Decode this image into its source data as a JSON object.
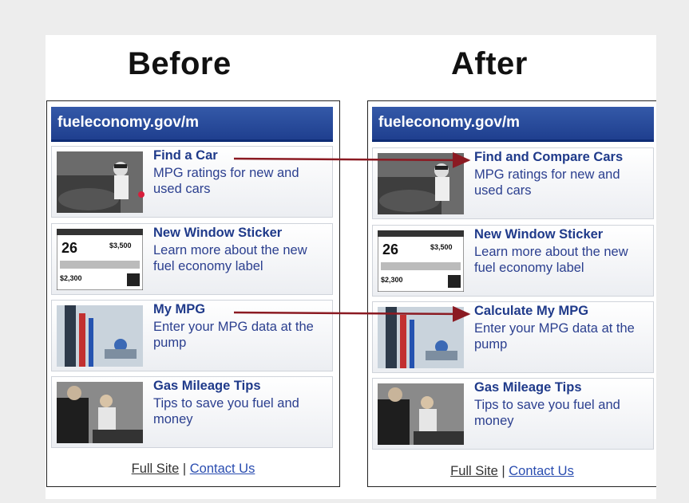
{
  "headings": {
    "before": "Before",
    "after": "After"
  },
  "site_header": "fueleconomy.gov/m",
  "before": {
    "cards": [
      {
        "title": "Find a Car",
        "desc": "MPG ratings for new and used cars",
        "thumb": "car-photo"
      },
      {
        "title": "New Window Sticker",
        "desc": "Learn more about the new fuel economy label",
        "thumb": "sticker-image"
      },
      {
        "title": "My MPG",
        "desc": "Enter your MPG data at the pump",
        "thumb": "fuel-pump-photo"
      },
      {
        "title": "Gas Mileage Tips",
        "desc": "Tips to save you fuel and money",
        "thumb": "engine-photo"
      }
    ]
  },
  "after": {
    "cards": [
      {
        "title": "Find and Compare Cars",
        "desc": "MPG ratings for new and used cars",
        "thumb": "car-photo"
      },
      {
        "title": "New Window Sticker",
        "desc": "Learn more about the new fuel economy label",
        "thumb": "sticker-image"
      },
      {
        "title": "Calculate My MPG",
        "desc": "Enter your MPG data at the pump",
        "thumb": "fuel-pump-photo"
      },
      {
        "title": "Gas Mileage Tips",
        "desc": "Tips to save you fuel and money",
        "thumb": "engine-photo"
      }
    ]
  },
  "footer": {
    "full_site": "Full Site",
    "separator": "|",
    "contact": "Contact Us"
  },
  "sticker": {
    "mpg": "26",
    "amount1": "$3,500",
    "amount2": "$2,300"
  },
  "colors": {
    "header_blue": "#1f3f8f",
    "title_blue": "#1f3a8a",
    "arrow_red": "#8b1a22"
  }
}
